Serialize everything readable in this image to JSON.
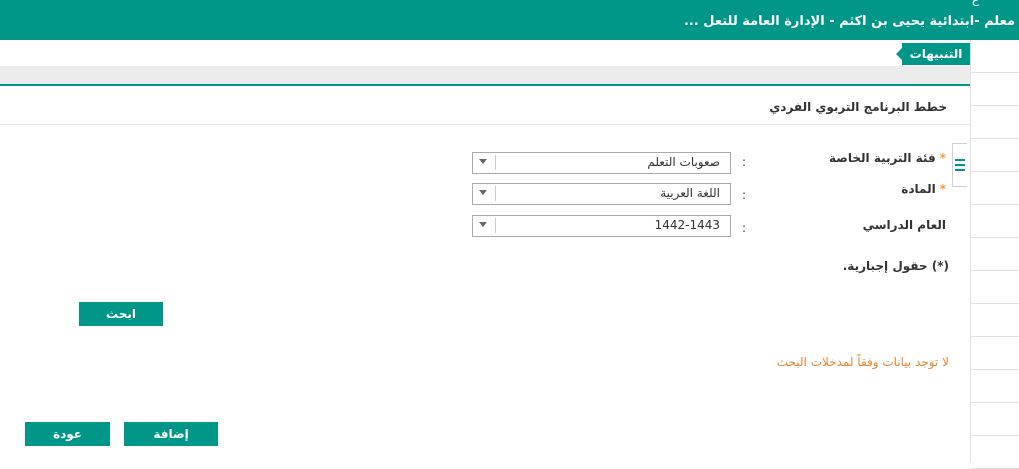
{
  "header": {
    "title_fragment": "ع",
    "title": "معلم -ابتدائية يحيى بن اكثم - الإدارة العامة للتعل ..."
  },
  "alerts_tab": {
    "label": "التنبيهات"
  },
  "panel": {
    "title": "خطط البرنامج التربوي الفردي"
  },
  "form": {
    "fields": [
      {
        "label": "فئة التربية الخاصة",
        "required_mark": "*",
        "colon": ":",
        "value": "صعوبات التعلم"
      },
      {
        "label": "المادة",
        "required_mark": "*",
        "colon": ":",
        "value": "اللغة العربية"
      },
      {
        "label": "العام الدراسي",
        "required_mark": "",
        "colon": ":",
        "value": "1442-1443"
      }
    ],
    "required_note": "(*) حقول إجبارية."
  },
  "buttons": {
    "search": "ابحث",
    "add": "إضافة",
    "back": "عودة"
  },
  "messages": {
    "no_data": "لا توجد بيانات وفقاً لمدخلات البحث"
  },
  "icons": {
    "menu_handle": "menu-icon",
    "dropdown_arrow": "chevron-down-icon"
  },
  "colors": {
    "accent": "#009688",
    "warning_text": "#e8833a",
    "required_mark": "#f0a030"
  }
}
